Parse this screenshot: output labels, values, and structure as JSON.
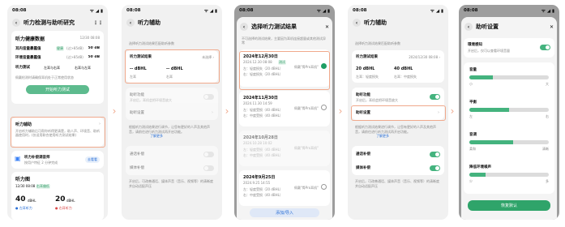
{
  "status": {
    "time": "08:08",
    "icons": "ᯤ ◢ ▮"
  },
  "p1": {
    "title": "听力检测与助听研究",
    "health": "听力健康数据",
    "health_date": "12/30 08:08",
    "rows": [
      {
        "label": "耳内音量暴露值",
        "badge": "健康",
        "note": "(过>85dB)",
        "val": "50 dB"
      },
      {
        "label": "环境音量暴露值",
        "badge": "",
        "note": "(过>85dB)",
        "val": "50 dB"
      }
    ],
    "test_label": "听力测试",
    "test_opts": [
      "左耳与右耳",
      "右耳与左耳"
    ],
    "note": "佩戴检测时请确保耳机处于正常使用状态",
    "test_btn": "开始听力测试",
    "assist": "听力辅助",
    "assist_desc": "开启听力辅助后可帮你听得更清楚，助人声、环境音、助听器使用时，(仅适用联合使用听力测试结果)",
    "plan": "听力补偿调音师",
    "plan_sub": "按用户特征 2 分钟完成",
    "plan_btn": "去看看",
    "map": "听力图",
    "map_date": "12/30 08:08",
    "map_badge": "右耳偏低",
    "left_val": "40",
    "right_val": "20",
    "unit": "dBHL",
    "left_lbl": "● 左耳听力",
    "right_lbl": "● 右耳听力"
  },
  "p2": {
    "title": "听力辅助",
    "desc": "选择听力测试结果匹配助听参数",
    "result_label": "听力测试结果",
    "result_val": "未选择 ›",
    "ears": [
      {
        "v": "-- dBHL",
        "l": "左耳"
      },
      {
        "v": "-- dBHL",
        "l": "右耳"
      }
    ],
    "opts": [
      {
        "label": "助听功能",
        "sub": "开启后，耳机会把环境音放大"
      },
      {
        "label": "助听设置"
      }
    ],
    "desc2": "根据听力测试结果进行调节，让您有更好的人声及其他声音，请前往进行听力测试再开启功能。",
    "link": "了解更多",
    "sw": [
      {
        "label": "通话补偿"
      },
      {
        "label": "媒体补偿"
      }
    ],
    "foot": "开启后，可改善通话、媒体声音（音乐、视频等）的清晰度并自动适配声压"
  },
  "p3": {
    "title": "选择听力测试结果",
    "desc": "不可选择的测试结果，主要因为耳机连接超量或其他测试异常",
    "items": [
      {
        "date": "2024年12月30日",
        "time": "2024.12.30 08:08",
        "tag": "测试",
        "l": "左：轻度损失（20 dBHL）",
        "r": "右：轻度损失（20 dBHL）",
        "status": "佩戴\"骨Pro耳机\"",
        "sel": true
      },
      {
        "date": "2024年11月30日",
        "time": "2024.11.30 14:59",
        "tag": "",
        "l": "左：轻度受损（40 dBHL）",
        "r": "右：中度受损（40 dBHL）",
        "status": "佩戴\"骨Pro耳机\"",
        "sel": false
      },
      {
        "date": "2024年10月28日",
        "time": "2024.10.28 10:02",
        "tag": "",
        "l": "左：轻度受损（40 dBHL）",
        "r": "右：中度受损（40 dBHL）",
        "status": "佩戴\"骨Pro耳机\"",
        "sel": false
      },
      {
        "date": "2024年9月25日",
        "time": "2024.9.25 14:55",
        "tag": "",
        "l": "左：轻度受损（20 dBHL）",
        "r": "右：中度受损（40 dBHL）",
        "status": "佩戴\"骨Pro耳机\"",
        "sel": false
      }
    ],
    "btn": "添加/导入"
  },
  "p4": {
    "title": "听力辅助",
    "desc": "选择听力测试结果匹配助听参数",
    "result_label": "听力测试结果",
    "result_val": "2024/12/30 08:08 ›",
    "ears": [
      {
        "v": "20 dBHL",
        "l": "左耳：轻度损失"
      },
      {
        "v": "40 dBHL",
        "l": "右耳：中度损失"
      }
    ],
    "opts": [
      {
        "label": "助听功能",
        "sub": "开启后，耳机会把环境音放大"
      },
      {
        "label": "助听设置"
      }
    ],
    "desc2": "根据听力测试结果进行调节，让您有更好的人声及其他声音，请前往进行听力测试再开启功能。",
    "link": "了解更多",
    "sw": [
      {
        "label": "通话补偿"
      },
      {
        "label": "媒体补偿"
      }
    ],
    "foot": "开启后，可改善通话、媒体声音（音乐、视频等）的清晰度并自动适配声压"
  },
  "p5": {
    "title": "助听设置",
    "env_label": "環境感知",
    "env_sub": "开启后，仅可以查看环境音量",
    "sliders": [
      {
        "label": "音量",
        "min": "小",
        "max": "大",
        "level": 0.3
      },
      {
        "label": "平衡",
        "min": "左",
        "max": "右",
        "level": 0.5
      },
      {
        "label": "音调",
        "min": "柔和",
        "max": "清晰",
        "level": 0.55
      },
      {
        "label": "降低环境噪声",
        "min": "少",
        "max": "多",
        "level": 0.2
      }
    ],
    "reset": "恢复默认"
  }
}
